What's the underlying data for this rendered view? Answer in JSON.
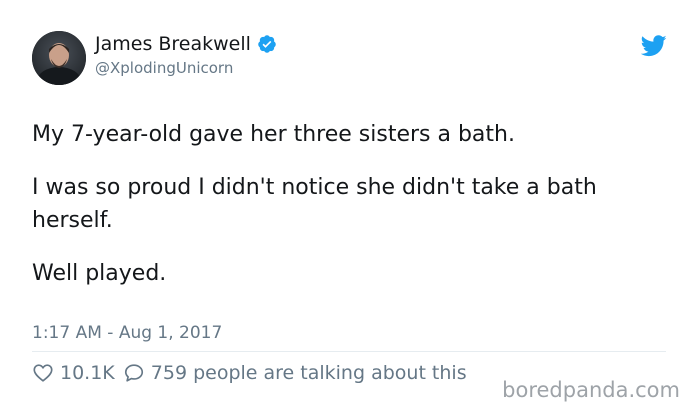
{
  "user": {
    "display_name": "James Breakwell",
    "handle": "@XplodingUnicorn",
    "verified": true
  },
  "tweet": {
    "paragraphs": [
      "My 7-year-old gave her three sisters a bath.",
      "I was so proud I didn't notice she didn't take a bath herself.",
      "Well played."
    ],
    "timestamp": "1:17 AM - Aug 1, 2017"
  },
  "stats": {
    "likes": "10.1K",
    "replies_text": "759 people are talking about this"
  },
  "watermark": "boredpanda.com",
  "icons": {
    "verified": "verified-badge-icon",
    "bird": "twitter-bird-icon",
    "like": "heart-icon",
    "reply": "speech-bubble-icon"
  },
  "colors": {
    "brand_blue": "#1da1f2",
    "text": "#14171a",
    "muted": "#657786"
  }
}
